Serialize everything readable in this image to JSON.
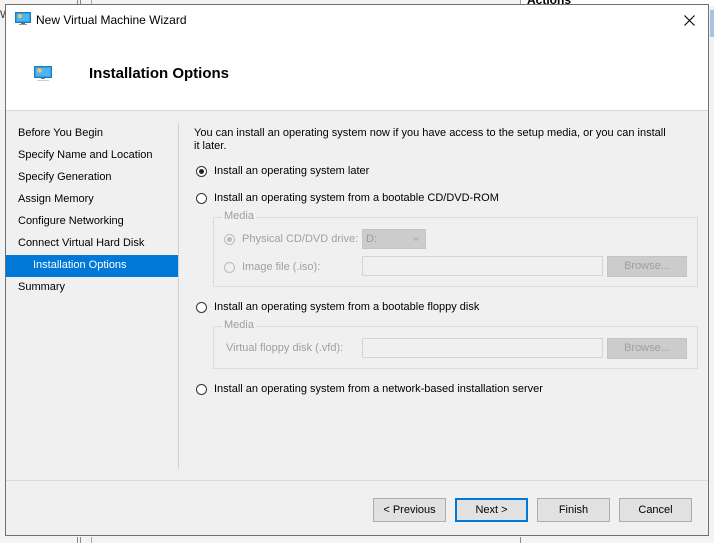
{
  "window": {
    "title": "New Virtual Machine Wizard",
    "close_icon": "close-icon",
    "app_icon": "virtual-machine-icon"
  },
  "background": {
    "actions_label": "Actions",
    "left_fragment": "W"
  },
  "header": {
    "title": "Installation Options",
    "icon": "virtual-machine-icon"
  },
  "nav": {
    "items": [
      {
        "label": "Before You Begin",
        "active": false
      },
      {
        "label": "Specify Name and Location",
        "active": false
      },
      {
        "label": "Specify Generation",
        "active": false
      },
      {
        "label": "Assign Memory",
        "active": false
      },
      {
        "label": "Configure Networking",
        "active": false
      },
      {
        "label": "Connect Virtual Hard Disk",
        "active": false
      },
      {
        "label": "Installation Options",
        "active": true
      },
      {
        "label": "Summary",
        "active": false
      }
    ]
  },
  "content": {
    "intro": "You can install an operating system now if you have access to the setup media, or you can install it later.",
    "options": {
      "later": {
        "label": "Install an operating system later",
        "checked": true
      },
      "cd_dvd": {
        "label": "Install an operating system from a bootable CD/DVD-ROM",
        "checked": false
      },
      "floppy": {
        "label": "Install an operating system from a bootable floppy disk",
        "checked": false
      },
      "network": {
        "label": "Install an operating system from a network-based installation server",
        "checked": false
      }
    },
    "cd_media": {
      "legend": "Media",
      "physical_label": "Physical CD/DVD drive:",
      "physical_checked": true,
      "drive_value": "D:",
      "image_label": "Image file (.iso):",
      "image_checked": false,
      "image_value": "",
      "browse_label": "Browse..."
    },
    "floppy_media": {
      "legend": "Media",
      "vfd_label": "Virtual floppy disk (.vfd):",
      "vfd_value": "",
      "browse_label": "Browse..."
    }
  },
  "footer": {
    "previous_label": "< Previous",
    "next_label": "Next >",
    "finish_label": "Finish",
    "cancel_label": "Cancel"
  },
  "colors": {
    "accent": "#0078d7",
    "dialog_bg": "#f0f0f0",
    "header_bg": "#ffffff",
    "disabled_text": "#a0a0a0"
  }
}
